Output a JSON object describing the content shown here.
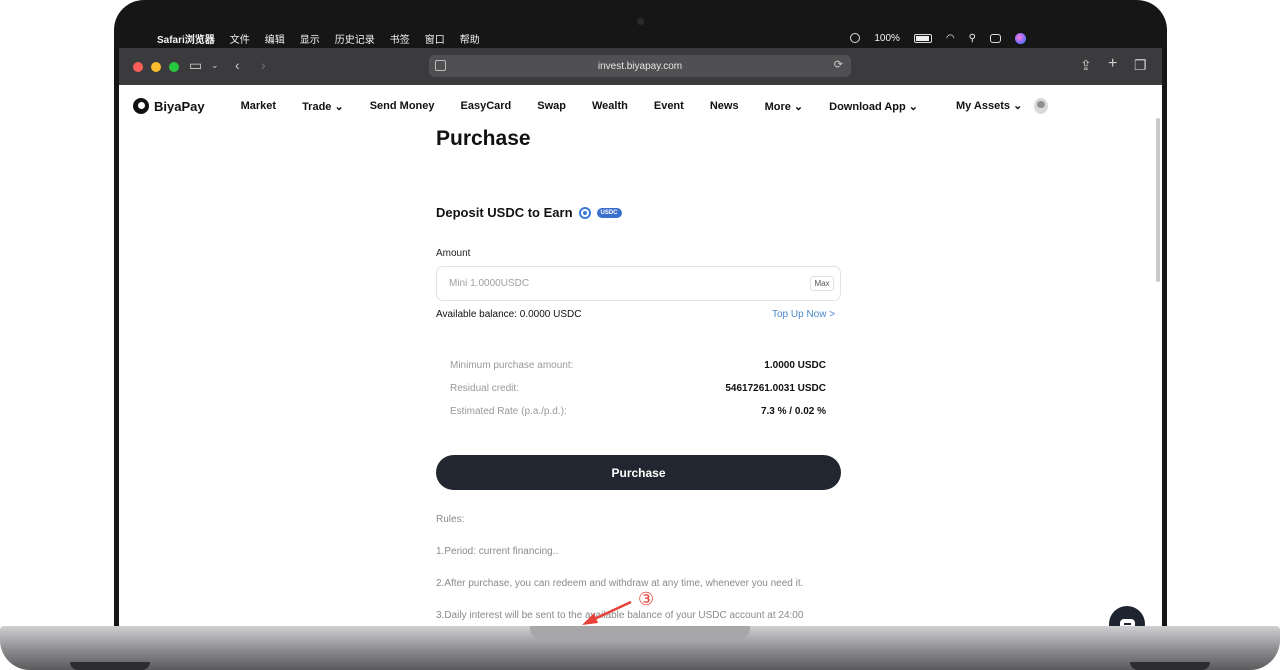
{
  "menubar": {
    "items": [
      "Safari浏览器",
      "文件",
      "编辑",
      "显示",
      "历史记录",
      "书签",
      "窗口",
      "帮助"
    ],
    "battery": "100%"
  },
  "browser": {
    "url": "invest.biyapay.com"
  },
  "nav": {
    "logo": "BiyaPay",
    "items": [
      "Market",
      "Trade",
      "Send Money",
      "EasyCard",
      "Swap",
      "Wealth",
      "Event",
      "News",
      "More",
      "Download App"
    ],
    "dropdown_items": [
      "Trade",
      "More",
      "Download App"
    ],
    "my_assets": "My Assets"
  },
  "page": {
    "title": "Purchase",
    "section_title": "Deposit USDC to Earn",
    "badge": "USDC",
    "amount_label": "Amount",
    "amount_placeholder": "Mini 1.0000USDC",
    "max_label": "Max",
    "balance_label": "Available balance: 0.0000 USDC",
    "topup_link": "Top Up Now >",
    "info": [
      {
        "key": "Minimum purchase amount:",
        "value": "1.0000 USDC"
      },
      {
        "key": "Residual credit:",
        "value": "54617261.0031 USDC"
      },
      {
        "key": "Estimated Rate (p.a./p.d.):",
        "value": "7.3 % / 0.02 %"
      }
    ],
    "purchase_button": "Purchase",
    "rules": [
      "Rules:",
      "1.Period: current financing..",
      "2.After purchase, you can redeem and withdraw at any time, whenever you need it.",
      "3.Daily interest will be sent to the available balance of your USDC account at 24:00"
    ]
  },
  "annotation": {
    "marker": "③",
    "color": "#e8413a"
  },
  "colors": {
    "button_dark": "#222630",
    "link_blue": "#4b89c7",
    "badge_blue": "#3b6fcc"
  }
}
